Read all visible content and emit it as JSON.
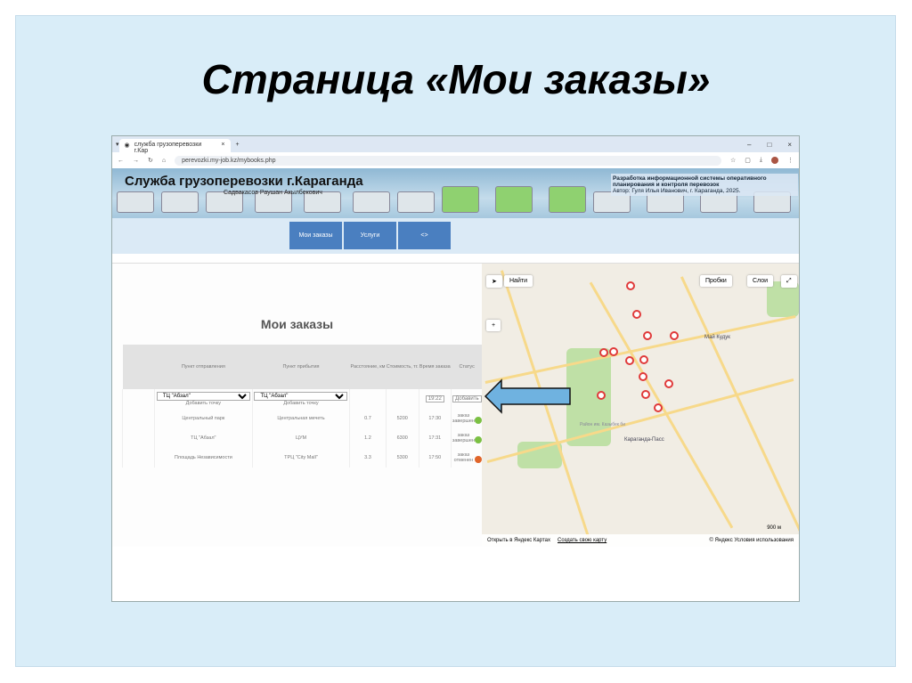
{
  "slide_title": "Страница «Мои заказы»",
  "browser": {
    "tab_title": "служба грузоперевозки г.Кар",
    "url": "perevozki.my-job.kz/mybooks.php"
  },
  "banner": {
    "title": "Служба грузоперевозки г.Караганда",
    "subtitle": "Садвакасов Раушан Акылбекович",
    "info_title": "Разработка информационной системы оперативного планирования и контроля перевозок",
    "info_author": "Автор: Гуля Илья Иванович, г. Караганда, 2025."
  },
  "nav": [
    "Мои заказы",
    "Услуги",
    "<>"
  ],
  "page": {
    "heading": "Мои заказы"
  },
  "table": {
    "headers": [
      "Пункт отправления",
      "Пункт прибытия",
      "Расстояние, км",
      "Стоимость, тг.",
      "Время заказа",
      "Статус"
    ],
    "new_row": {
      "from": "ТЦ \"Абзал\"",
      "to": "ТЦ \"Абзал\"",
      "add_point": "Добавить точку",
      "time": "19:22",
      "add_button": "Добавить"
    },
    "rows": [
      {
        "from": "Центральный парк",
        "to": "Центральная мечеть",
        "distance": "0.7",
        "cost": "5200",
        "time": "17:30",
        "status": "заказ завершен",
        "state": "done"
      },
      {
        "from": "ТЦ \"Абзал\"",
        "to": "ЦУМ",
        "distance": "1.2",
        "cost": "6300",
        "time": "17:31",
        "status": "заказ завершен",
        "state": "done"
      },
      {
        "from": "Площадь Независимости",
        "to": "ТРЦ \"City Mall\"",
        "distance": "3.3",
        "cost": "5300",
        "time": "17:50",
        "status": "заказ отменен",
        "state": "cancelled"
      }
    ]
  },
  "map": {
    "find": "Найти",
    "traffic": "Пробки",
    "layers": "Слои",
    "zoom_in": "+",
    "scale": "900 м",
    "open": "Открыть в Яндекс Картах",
    "create": "Создать свою карту",
    "terms": "© Яндекс Условия использования",
    "labels": [
      "Караганда-Пасс",
      "Май Кудук",
      "Район им. Казыбек би"
    ]
  },
  "colors": {
    "nav": "#4a7fc0",
    "marker": "#e03a3a",
    "slide_bg": "#d9edf8"
  }
}
